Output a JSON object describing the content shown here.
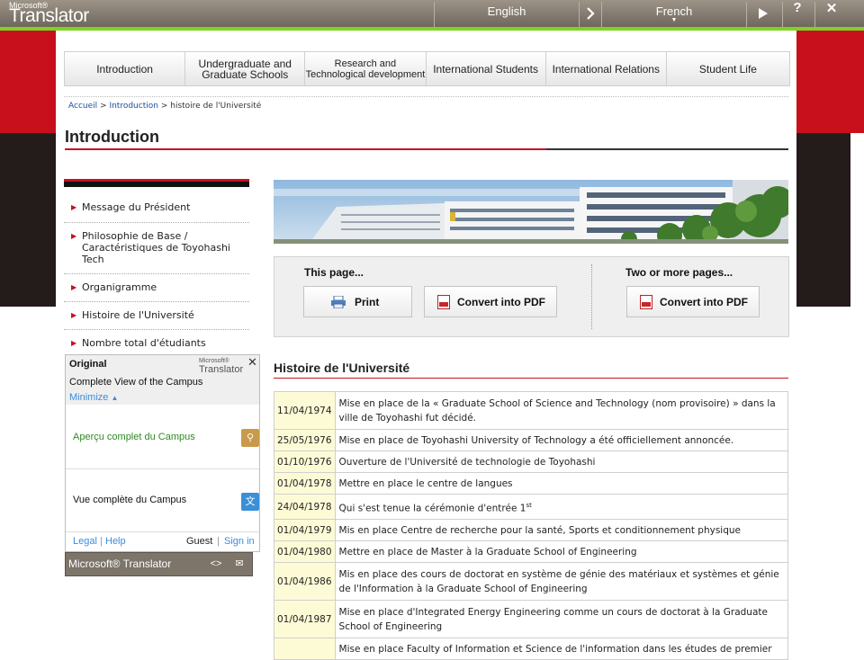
{
  "translator_bar": {
    "brand_small": "Microsoft®",
    "brand": "Translator",
    "from_lang": "English",
    "to_lang": "French",
    "swap_icon": "chevron-right-icon",
    "play_icon": "play-icon",
    "help_label": "?",
    "close_label": "✕"
  },
  "nav": {
    "items": [
      {
        "label": "Introduction"
      },
      {
        "label": "Undergraduate and Graduate Schools"
      },
      {
        "label": "Research and Technological development"
      },
      {
        "label": "International Students"
      },
      {
        "label": "International Relations"
      },
      {
        "label": "Student Life"
      }
    ]
  },
  "breadcrumb": {
    "home": "Accueil",
    "section": "Introduction",
    "current": "histoire de l'Université",
    "sep": ">"
  },
  "page_title": "Introduction",
  "sidebar": {
    "items": [
      {
        "label": "Message du Président"
      },
      {
        "label": "Philosophie de Base / Caractéristiques de Toyohashi Tech"
      },
      {
        "label": "Organigramme"
      },
      {
        "label": "Histoire de l'Université"
      },
      {
        "label": "Nombre total d'étudiants"
      }
    ]
  },
  "print_box": {
    "this_page": "This page...",
    "print": "Print",
    "convert": "Convert into PDF",
    "more_pages": "Two or more pages...",
    "convert2": "Convert into PDF"
  },
  "history": {
    "title": "Histoire de l'Université",
    "rows": [
      {
        "date": "11/04/1974",
        "text": "Mise en place de la « Graduate School of Science and Technology (nom provisoire) » dans la ville de Toyohashi fut décidé."
      },
      {
        "date": "25/05/1976",
        "text": "Mise en place de Toyohashi University of Technology a été officiellement annoncée."
      },
      {
        "date": "01/10/1976",
        "text": "Ouverture de l'Université de technologie de Toyohashi"
      },
      {
        "date": "01/04/1978",
        "text": "Mettre en place le centre de langues"
      },
      {
        "date": "24/04/1978",
        "text": "Qui s'est tenue la cérémonie d'entrée 1",
        "sup": "st"
      },
      {
        "date": "01/04/1979",
        "text": "Mis en place Centre de recherche pour la santé, Sports et conditionnement physique"
      },
      {
        "date": "01/04/1980",
        "text": "Mettre en place de Master à la Graduate School of Engineering"
      },
      {
        "date": "01/04/1986",
        "text": "Mis en place des cours de doctorat en système de génie des matériaux et systèmes et génie de l'Information à la Graduate School of Engineering"
      },
      {
        "date": "01/04/1987",
        "text": "Mise en place d'Integrated Energy Engineering comme un cours de doctorat à la Graduate School of Engineering"
      },
      {
        "date": "",
        "text": "Mise en place Faculty of Information et Science de l'information dans les études de premier"
      }
    ]
  },
  "translator_panel": {
    "original_label": "Original",
    "brand_small": "Microsoft®",
    "brand": "Translator",
    "close_label": "✕",
    "source_text": "Complete View of the Campus",
    "minimize": "Minimize",
    "translation1": "Aperçu complet du Campus",
    "translation2": "Vue complète du Campus",
    "legal": "Legal",
    "help": "Help",
    "guest": "Guest",
    "sign_in": "Sign in",
    "footer_brand": "Microsoft® Translator",
    "embed_icon": "code-icon",
    "mail_icon": "mail-icon"
  },
  "colors": {
    "accent_red": "#c8101d",
    "dark_band": "#231c1a",
    "translator_green": "#7ed321",
    "date_cell": "#fdfbd6"
  }
}
